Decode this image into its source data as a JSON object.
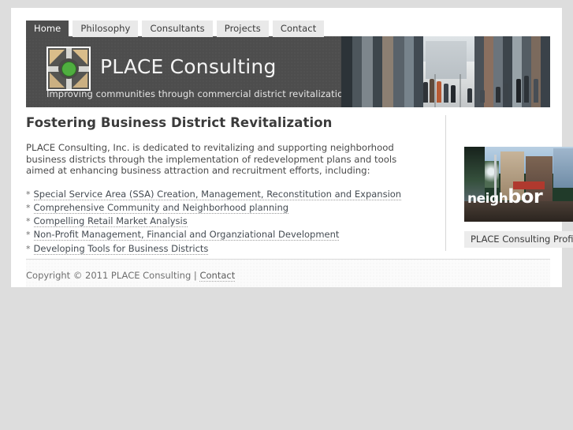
{
  "nav": {
    "tabs": [
      {
        "label": "Home",
        "active": true
      },
      {
        "label": "Philosophy",
        "active": false
      },
      {
        "label": "Consultants",
        "active": false
      },
      {
        "label": "Projects",
        "active": false
      },
      {
        "label": "Contact",
        "active": false
      }
    ]
  },
  "header": {
    "brand_title": "PLACE Consulting",
    "tagline": "Improving communities through commercial district revitalization",
    "logo_icon": "place-roundabout-logo-icon",
    "banner_photo_alt": "pedestrian shopping street with crowds"
  },
  "main": {
    "page_title": "Fostering Business District Revitalization",
    "intro": "PLACE Consulting, Inc. is dedicated to revitalizing and supporting neighborhood business districts through the implementation of redevelopment plans and tools aimed at enhancing business attraction and recruitment efforts, including:",
    "services": [
      "Special Service Area (SSA) Creation, Management, Reconstitution and Expansion",
      "Comprehensive Community and Neighborhood planning",
      "Compelling Retail Market Analysis",
      "Non-Profit Management, Financial and Organziational Development",
      "Developing Tools for Business Districts"
    ],
    "bullet_marker": "*"
  },
  "sidebar": {
    "photo_word_prefix": "neigh",
    "photo_word_suffix": "bor",
    "photo_alt": "storefront window reading neighbor",
    "profile_button": "PLACE Consulting Profile"
  },
  "footer": {
    "copyright": "Copyright © 2011 PLACE Consulting | ",
    "contact_link": "Contact"
  },
  "colors": {
    "page_background": "#dddddd",
    "container": "#ffffff",
    "banner_dark": "#4d4d4d",
    "tab_active_bg": "#4e4e4e",
    "tab_inactive_bg": "#e9e9e9",
    "logo_green": "#4fae3f",
    "logo_tan": "#d9bd8a",
    "text_body": "#4a4a4a",
    "link_dotted": "#444b52"
  }
}
